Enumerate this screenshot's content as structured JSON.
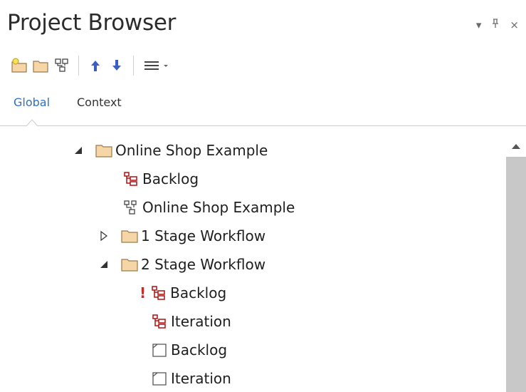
{
  "panel": {
    "title": "Project Browser"
  },
  "window_buttons": [
    {
      "name": "dropdown-arrow-icon",
      "glyph": "▾"
    },
    {
      "name": "pin-icon",
      "glyph": "⊥"
    },
    {
      "name": "close-icon",
      "glyph": "×"
    }
  ],
  "toolbar": {
    "buttons": [
      "new-model-icon",
      "new-package-icon",
      "new-diagram-icon",
      "move-up-icon",
      "move-down-icon",
      "menu-icon"
    ]
  },
  "tabs": [
    {
      "label": "Global",
      "active": true
    },
    {
      "label": "Context",
      "active": false
    }
  ],
  "tree": [
    {
      "label": "Online Shop Example",
      "icon": "package-icon",
      "expander": "expanded",
      "depth": 0
    },
    {
      "label": "Backlog",
      "icon": "kanban-icon",
      "expander": "none",
      "depth": 1
    },
    {
      "label": "Online Shop Example",
      "icon": "diagram-icon",
      "expander": "none",
      "depth": 1
    },
    {
      "label": "1 Stage Workflow",
      "icon": "package-icon",
      "expander": "collapsed",
      "depth": 1
    },
    {
      "label": "2 Stage Workflow",
      "icon": "package-icon",
      "expander": "expanded",
      "depth": 1
    },
    {
      "label": "Backlog",
      "icon": "kanban-icon",
      "expander": "none",
      "depth": 2,
      "warning": "!"
    },
    {
      "label": "Iteration",
      "icon": "kanban-icon",
      "expander": "none",
      "depth": 2
    },
    {
      "label": "Backlog",
      "icon": "element-icon",
      "expander": "none",
      "depth": 2
    },
    {
      "label": "Iteration",
      "icon": "element-icon",
      "expander": "none",
      "depth": 2
    }
  ],
  "colors": {
    "accent": "#2e6fc6",
    "folder": "#f6d6a6",
    "warning": "#e02020",
    "scrollbar": "#c8c8c8"
  }
}
